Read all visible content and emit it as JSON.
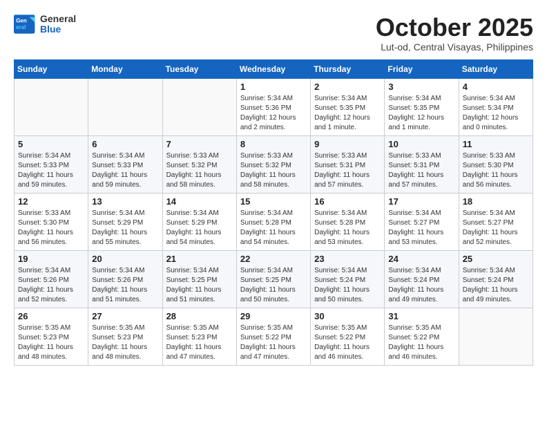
{
  "header": {
    "logo": {
      "line1": "General",
      "line2": "Blue"
    },
    "title": "October 2025",
    "subtitle": "Lut-od, Central Visayas, Philippines"
  },
  "weekdays": [
    "Sunday",
    "Monday",
    "Tuesday",
    "Wednesday",
    "Thursday",
    "Friday",
    "Saturday"
  ],
  "weeks": [
    [
      {
        "day": "",
        "info": ""
      },
      {
        "day": "",
        "info": ""
      },
      {
        "day": "",
        "info": ""
      },
      {
        "day": "1",
        "info": "Sunrise: 5:34 AM\nSunset: 5:36 PM\nDaylight: 12 hours\nand 2 minutes."
      },
      {
        "day": "2",
        "info": "Sunrise: 5:34 AM\nSunset: 5:35 PM\nDaylight: 12 hours\nand 1 minute."
      },
      {
        "day": "3",
        "info": "Sunrise: 5:34 AM\nSunset: 5:35 PM\nDaylight: 12 hours\nand 1 minute."
      },
      {
        "day": "4",
        "info": "Sunrise: 5:34 AM\nSunset: 5:34 PM\nDaylight: 12 hours\nand 0 minutes."
      }
    ],
    [
      {
        "day": "5",
        "info": "Sunrise: 5:34 AM\nSunset: 5:33 PM\nDaylight: 11 hours\nand 59 minutes."
      },
      {
        "day": "6",
        "info": "Sunrise: 5:34 AM\nSunset: 5:33 PM\nDaylight: 11 hours\nand 59 minutes."
      },
      {
        "day": "7",
        "info": "Sunrise: 5:33 AM\nSunset: 5:32 PM\nDaylight: 11 hours\nand 58 minutes."
      },
      {
        "day": "8",
        "info": "Sunrise: 5:33 AM\nSunset: 5:32 PM\nDaylight: 11 hours\nand 58 minutes."
      },
      {
        "day": "9",
        "info": "Sunrise: 5:33 AM\nSunset: 5:31 PM\nDaylight: 11 hours\nand 57 minutes."
      },
      {
        "day": "10",
        "info": "Sunrise: 5:33 AM\nSunset: 5:31 PM\nDaylight: 11 hours\nand 57 minutes."
      },
      {
        "day": "11",
        "info": "Sunrise: 5:33 AM\nSunset: 5:30 PM\nDaylight: 11 hours\nand 56 minutes."
      }
    ],
    [
      {
        "day": "12",
        "info": "Sunrise: 5:33 AM\nSunset: 5:30 PM\nDaylight: 11 hours\nand 56 minutes."
      },
      {
        "day": "13",
        "info": "Sunrise: 5:34 AM\nSunset: 5:29 PM\nDaylight: 11 hours\nand 55 minutes."
      },
      {
        "day": "14",
        "info": "Sunrise: 5:34 AM\nSunset: 5:29 PM\nDaylight: 11 hours\nand 54 minutes."
      },
      {
        "day": "15",
        "info": "Sunrise: 5:34 AM\nSunset: 5:28 PM\nDaylight: 11 hours\nand 54 minutes."
      },
      {
        "day": "16",
        "info": "Sunrise: 5:34 AM\nSunset: 5:28 PM\nDaylight: 11 hours\nand 53 minutes."
      },
      {
        "day": "17",
        "info": "Sunrise: 5:34 AM\nSunset: 5:27 PM\nDaylight: 11 hours\nand 53 minutes."
      },
      {
        "day": "18",
        "info": "Sunrise: 5:34 AM\nSunset: 5:27 PM\nDaylight: 11 hours\nand 52 minutes."
      }
    ],
    [
      {
        "day": "19",
        "info": "Sunrise: 5:34 AM\nSunset: 5:26 PM\nDaylight: 11 hours\nand 52 minutes."
      },
      {
        "day": "20",
        "info": "Sunrise: 5:34 AM\nSunset: 5:26 PM\nDaylight: 11 hours\nand 51 minutes."
      },
      {
        "day": "21",
        "info": "Sunrise: 5:34 AM\nSunset: 5:25 PM\nDaylight: 11 hours\nand 51 minutes."
      },
      {
        "day": "22",
        "info": "Sunrise: 5:34 AM\nSunset: 5:25 PM\nDaylight: 11 hours\nand 50 minutes."
      },
      {
        "day": "23",
        "info": "Sunrise: 5:34 AM\nSunset: 5:24 PM\nDaylight: 11 hours\nand 50 minutes."
      },
      {
        "day": "24",
        "info": "Sunrise: 5:34 AM\nSunset: 5:24 PM\nDaylight: 11 hours\nand 49 minutes."
      },
      {
        "day": "25",
        "info": "Sunrise: 5:34 AM\nSunset: 5:24 PM\nDaylight: 11 hours\nand 49 minutes."
      }
    ],
    [
      {
        "day": "26",
        "info": "Sunrise: 5:35 AM\nSunset: 5:23 PM\nDaylight: 11 hours\nand 48 minutes."
      },
      {
        "day": "27",
        "info": "Sunrise: 5:35 AM\nSunset: 5:23 PM\nDaylight: 11 hours\nand 48 minutes."
      },
      {
        "day": "28",
        "info": "Sunrise: 5:35 AM\nSunset: 5:23 PM\nDaylight: 11 hours\nand 47 minutes."
      },
      {
        "day": "29",
        "info": "Sunrise: 5:35 AM\nSunset: 5:22 PM\nDaylight: 11 hours\nand 47 minutes."
      },
      {
        "day": "30",
        "info": "Sunrise: 5:35 AM\nSunset: 5:22 PM\nDaylight: 11 hours\nand 46 minutes."
      },
      {
        "day": "31",
        "info": "Sunrise: 5:35 AM\nSunset: 5:22 PM\nDaylight: 11 hours\nand 46 minutes."
      },
      {
        "day": "",
        "info": ""
      }
    ]
  ]
}
